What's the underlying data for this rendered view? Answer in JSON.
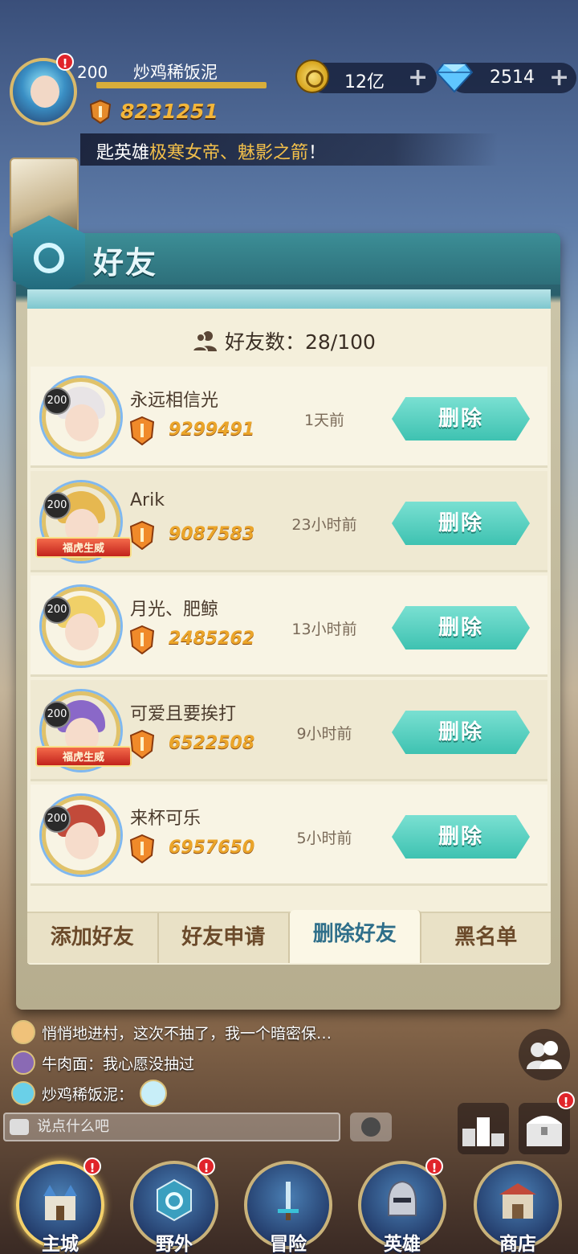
{
  "player": {
    "level": "200",
    "name": "炒鸡稀饭泥",
    "power": "8231251"
  },
  "resources": {
    "gold": "12亿",
    "gems": "2514"
  },
  "ticker": {
    "prefix": "匙英雄",
    "highlight": "极寒女帝、魅影之箭",
    "suffix": "！"
  },
  "dialog": {
    "title": "好友",
    "friend_count_label": "好友数：28/100"
  },
  "friends": [
    {
      "level": "200",
      "name": "永远相信光",
      "power": "9299491",
      "last_seen": "1天前",
      "banner": "",
      "hair": "#e8e4e6",
      "action": "删除"
    },
    {
      "level": "200",
      "name": "Arik",
      "power": "9087583",
      "last_seen": "23小时前",
      "banner": "福虎生威",
      "hair": "#e6b850",
      "action": "删除"
    },
    {
      "level": "200",
      "name": "月光、肥鲸",
      "power": "2485262",
      "last_seen": "13小时前",
      "banner": "",
      "hair": "#f0d068",
      "action": "删除"
    },
    {
      "level": "200",
      "name": "可爱且要挨打",
      "power": "6522508",
      "last_seen": "9小时前",
      "banner": "福虎生威",
      "hair": "#8a68c8",
      "action": "删除"
    },
    {
      "level": "200",
      "name": "来杯可乐",
      "power": "6957650",
      "last_seen": "5小时前",
      "banner": "",
      "hair": "#c24a3a",
      "action": "删除"
    }
  ],
  "tabs": [
    {
      "label": "添加好友",
      "active": false
    },
    {
      "label": "好友申请",
      "active": false
    },
    {
      "label": "删除好友",
      "active": true
    },
    {
      "label": "黑名单",
      "active": false
    }
  ],
  "chat": {
    "messages": [
      {
        "text": "悄悄地进村，这次不抽了，我一个暗密保…"
      },
      {
        "text": "牛肉面：我心愿没抽过"
      },
      {
        "text": "炒鸡稀饭泥："
      }
    ],
    "input_placeholder": "说点什么吧"
  },
  "nav": [
    {
      "label": "主城",
      "alert": true,
      "active": true
    },
    {
      "label": "野外",
      "alert": true,
      "active": false
    },
    {
      "label": "冒险",
      "alert": false,
      "active": false
    },
    {
      "label": "英雄",
      "alert": true,
      "active": false
    },
    {
      "label": "商店",
      "alert": false,
      "active": false
    }
  ],
  "colors": {
    "accent_teal": "#3ec2b1",
    "power_gold": "#eba52a",
    "alert_red": "#e0242a"
  }
}
